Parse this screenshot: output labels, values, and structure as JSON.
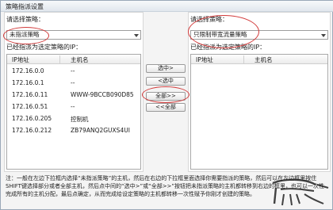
{
  "window": {
    "title": "策略指派设置"
  },
  "left": {
    "select_label": "请选择策略：",
    "selected": "未指派策略",
    "list_label": "已经指派为选定策略的IP：",
    "columns": [
      "IP地址",
      "主机名"
    ],
    "rows": [
      {
        "ip": "172.16.0.0",
        "host": "--"
      },
      {
        "ip": "172.16.0.1",
        "host": "--"
      },
      {
        "ip": "172.16.0.11",
        "host": "WWW-9BCCB090D85"
      },
      {
        "ip": "172.16.0.51",
        "host": "--"
      },
      {
        "ip": "172.16.0.205",
        "host": "控制机"
      },
      {
        "ip": "172.16.0.212",
        "host": "ZB79ANQ2GUXS4UI"
      }
    ]
  },
  "right": {
    "select_label": "请选择策略：",
    "selected": "只限制带宽流量策略",
    "list_label": "已经指派为选定策略的IP：",
    "columns": [
      "IP地址",
      "主机名"
    ]
  },
  "buttons": {
    "select": "选中>",
    "back": "<选中",
    "all": "全部>>",
    "all_back": "<<全部"
  },
  "note": "注：一般在左边下拉框内选择“未指派策略”的主机，然后在右边的下拉框里面选择你需要指派的策略，然后可以在左边框里按住SHIFT键选择部分或者全部主机，然后点中间的“选中>”或“全部>>”按钮把未指派策略的主机都转移到右边的框里，也可以一次性完成所有的主机分配，最后点确定，从而完成给设定策略的主机都转移一次性赋予你刚才创建的策略。",
  "watermark": "广东龙网",
  "colors": {
    "annotation": "#d23a3a",
    "accent": "#d23a3a"
  }
}
